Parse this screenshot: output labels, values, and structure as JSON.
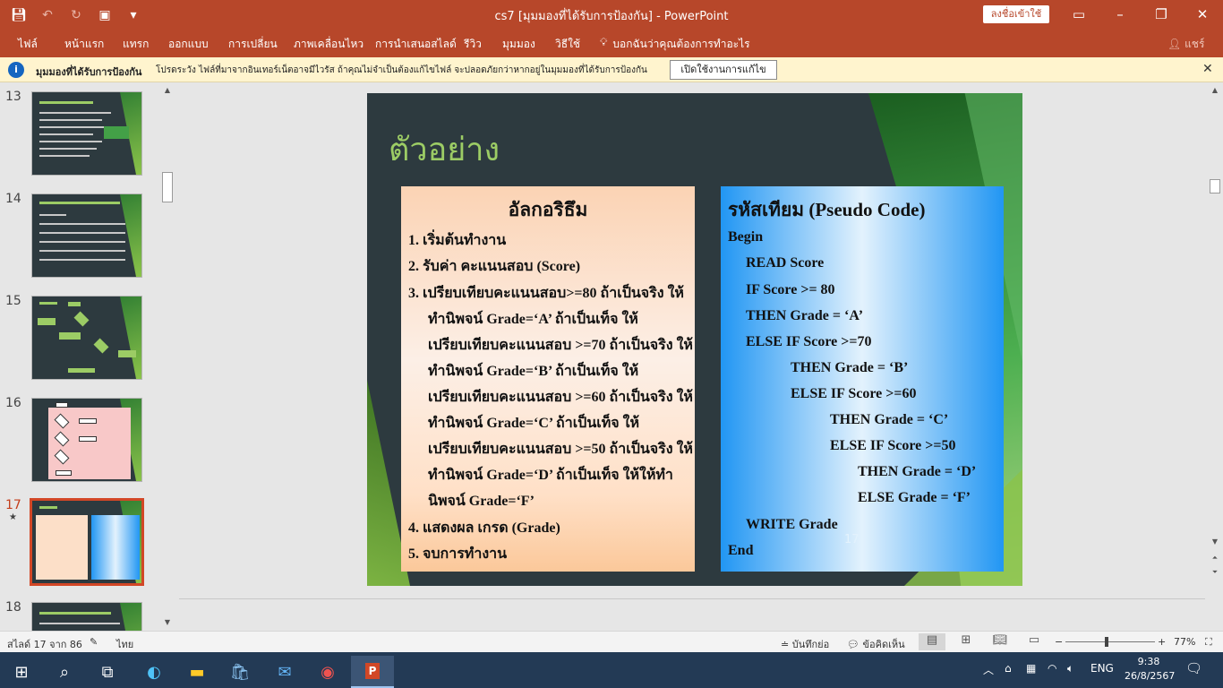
{
  "titlebar": {
    "title": "cs7 [มุมมองที่ได้รับการป้องกัน]  -  PowerPoint",
    "signin_label": "ลงชื่อเข้าใช้",
    "quick_access": [
      "save-icon",
      "undo-icon",
      "redo-icon",
      "present-icon",
      "customize-icon"
    ]
  },
  "ribbon": {
    "tabs": [
      "ไฟล์",
      "หน้าแรก",
      "แทรก",
      "ออกแบบ",
      "การเปลี่ยน",
      "ภาพเคลื่อนไหว",
      "การนำเสนอสไลด์",
      "รีวิว",
      "มุมมอง",
      "วิธีใช้"
    ],
    "tell_me": "บอกฉันว่าคุณต้องการทำอะไร",
    "share": "แชร์"
  },
  "protected_view": {
    "title": "มุมมองที่ได้รับการป้องกัน",
    "message": "โปรดระวัง ไฟล์ที่มาจากอินเทอร์เน็ตอาจมีไวรัส ถ้าคุณไม่จำเป็นต้องแก้ไขไฟล์ จะปลอดภัยกว่าหากอยู่ในมุมมองที่ได้รับการป้องกัน",
    "enable_button": "เปิดใช้งานการแก้ไข"
  },
  "thumbnails": [
    {
      "number": "13"
    },
    {
      "number": "14"
    },
    {
      "number": "15"
    },
    {
      "number": "16"
    },
    {
      "number": "17",
      "star": "★"
    },
    {
      "number": "18"
    }
  ],
  "slide": {
    "title": "ตัวอย่าง",
    "number": "17",
    "algorithm": {
      "heading": "อัลกอริธึม",
      "lines": [
        "1.  เริ่มต้นทำงาน",
        "2.  รับค่า คะแนนสอบ (Score)",
        "3.  เปรียบเทียบคะแนนสอบ>=80 ถ้าเป็นจริง ให้",
        "ทำนิพจน์ Grade=‘A’ ถ้าเป็นเท็จ ให้",
        "เปรียบเทียบคะแนนสอบ >=70 ถ้าเป็นจริง ให้",
        "ทำนิพจน์ Grade=‘B’ ถ้าเป็นเท็จ ให้",
        "เปรียบเทียบคะแนนสอบ >=60 ถ้าเป็นจริง ให้",
        "ทำนิพจน์ Grade=‘C’ ถ้าเป็นเท็จ ให้",
        "เปรียบเทียบคะแนนสอบ >=50 ถ้าเป็นจริง ให้",
        "ทำนิพจน์ Grade=‘D’ ถ้าเป็นเท็จ ให้ให้ทำ",
        "นิพจน์ Grade=‘F’",
        "4.  แสดงผล เกรด (Grade)",
        "5.  จบการทำงาน"
      ]
    },
    "pseudo": {
      "heading": "รหัสเทียม (Pseudo Code)",
      "lines": [
        "Begin",
        "READ  Score",
        "IF Score >= 80",
        "THEN Grade = ‘A’",
        "ELSE  IF Score >=70",
        "THEN Grade = ‘B’",
        "ELSE IF Score >=60",
        "THEN Grade = ‘C’",
        "ELSE IF Score >=50",
        "THEN Grade = ‘D’",
        "ELSE Grade = ‘F’",
        "WRITE Grade",
        "End"
      ]
    }
  },
  "statusbar": {
    "slide_info": "สไลด์ 17 จาก 86",
    "language": "ไทย",
    "notes": "บันทึกย่อ",
    "comments": "ข้อคิดเห็น",
    "zoom": "77%",
    "zoom_level": 0.46
  },
  "taskbar": {
    "apps": [
      "windows-start-icon",
      "search-icon",
      "task-view-icon",
      "edge-icon",
      "file-explorer-icon",
      "store-icon",
      "mail-icon",
      "chrome-icon",
      "powerpoint-icon"
    ],
    "lang": "ENG",
    "time": "9:38",
    "date": "26/8/2567"
  },
  "colors": {
    "accent": "#b7472a",
    "slide_bg": "#2d3a3f",
    "title_green": "#9ccc65",
    "active_thumb_border": "#d24726"
  }
}
